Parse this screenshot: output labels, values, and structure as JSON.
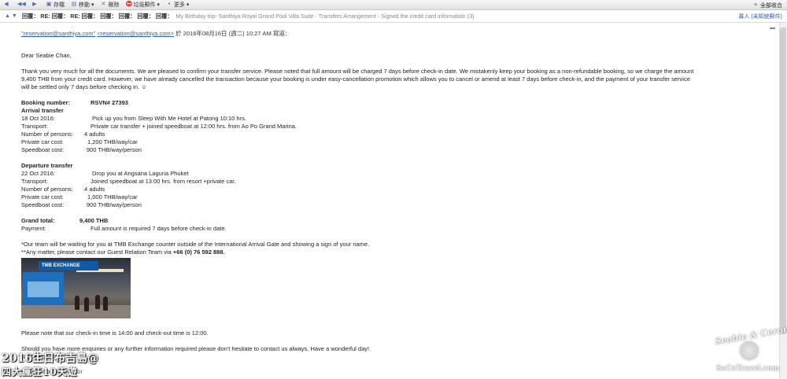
{
  "toolbar": {
    "items": [
      {
        "icon": "back-arrow-icon",
        "label": ""
      },
      {
        "icon": "back-all-icon",
        "label": ""
      },
      {
        "icon": "forward-icon",
        "label": ""
      },
      {
        "icon": "save-icon",
        "label": "存檔"
      },
      {
        "icon": "move-icon",
        "label": "移動 ▾"
      },
      {
        "icon": "delete-icon",
        "label": "刪除"
      },
      {
        "icon": "spam-icon",
        "label": "垃圾郵件 ▾"
      },
      {
        "icon": "more-icon",
        "label": "更多 ▾"
      }
    ],
    "right": {
      "icon": "expand-all-icon",
      "label": "全部收合"
    }
  },
  "subject": {
    "arrow": "▲ ▼",
    "prefix": "回覆： RE: 回覆： RE: 回覆： 回覆： 回覆： 回覆： 回覆：",
    "title": "My Birthday trip- Santhiya Royal Grand Pool Villa Suite - Transfers Arrangement - Signed the credit card information (3)",
    "recipients": "寡人 (未知統郵件)"
  },
  "mail": {
    "from_link1": "\"reservation@santhiya.com\"",
    "from_link2": "<reservation@santhiya.com>",
    "from_text": "於 2016年08月16日 (週二) 10:27 AM 寫道：",
    "greeting": "Dear Seabie Chan,",
    "intro": [
      "Thank you very much for all the documents. We are pleased to confirm your transfer service. Please noted that full amount will be charged 7 days before check-in date. We mistakenly keep your booking as a non-refundable booking, so we charge the amount",
      "9,400 THB from your credit card. However, we have already cancelled the transaction because your booking is under easy-cancellation promotion which allows you to cancel or amend at least 7 days before check-in, and the payment of your transfer service",
      "will be settled only 7 days before checking in. ☺"
    ],
    "booking": {
      "label": "Booking number:",
      "value": "RSVN# 27393"
    },
    "arrival": {
      "heading": "Arrival transfer",
      "date_label": "18 Oct 2016:",
      "date_value": "Pick up you from Sleep With Me Hotel at Patong 10:10 hrs.",
      "transport_label": "Transport:",
      "transport_value": "Private car transfer + joined speedboat at 12:00 hrs. from Ao Po Grand Marina.",
      "persons_label": "Number of persons:",
      "persons_value": "4 adults",
      "car_label": "Private car cost:",
      "car_value": "1,200 THB/way/car",
      "boat_label": "Speedboat cost:",
      "boat_value": "900 THB/way/person"
    },
    "departure": {
      "heading": "Departure transfer",
      "date_label": "22 Oct 2016:",
      "date_value": "Drop you at Angsana Laguna Phuket",
      "transport_label": "Transport:",
      "transport_value": "Joined speedboat at 13:00 hrs. from resort +private car.",
      "persons_label": "Number of persons:",
      "persons_value": "4 adults",
      "car_label": "Private car cost:",
      "car_value": "1,000 THB/way/car",
      "boat_label": "Speedboat cost:",
      "boat_value": "900 THB/way/person"
    },
    "total": {
      "label": "Grand total:",
      "value": "9,400 THB"
    },
    "payment": {
      "label": "Payment:",
      "value": "Full amount is required 7 days before check-in date."
    },
    "team_note": "*Our team will be waiting for you at TMB Exchange counter outside of the International Arrival Gate and showing a sign of your name.",
    "any_matter": "**Any matter, please contact our Guest Relation Team via",
    "phone": "+66 (0) 76 592 888.",
    "photo_sign": "TMB EXCHANGE",
    "checkin": "Please note that our check-in time is 14:00 and check-out time is 12:00.",
    "closing": "Should you have more enquiries or any further information required please don't hesitate to contact us always.  Have a wonderful day!",
    "sign_partial": "Best Regards,",
    "sign_role": "Reservation Supervisor"
  },
  "overlay": {
    "line1": "2016生日布吉島@",
    "line2": "四大瘋狂10天遊"
  },
  "watermark": {
    "top": "Seabie & Ceron",
    "bottom": "SeCeTravel.com"
  }
}
